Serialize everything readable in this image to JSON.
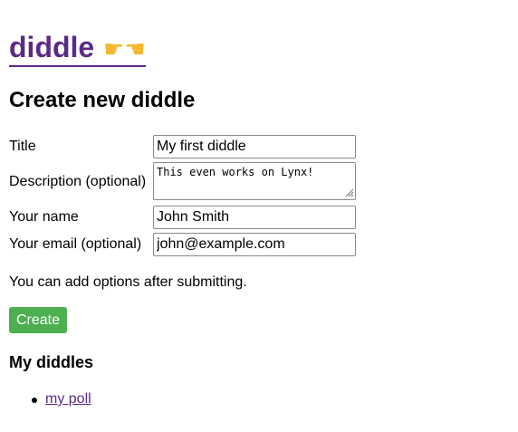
{
  "header": {
    "logo_text": "diddle",
    "logo_icon": "pointing-hands-emoji"
  },
  "form": {
    "heading": "Create new diddle",
    "fields": [
      {
        "label": "Title",
        "value": "My first diddle"
      },
      {
        "label": "Description (optional)",
        "value": "This even works on Lynx!"
      },
      {
        "label": "Your name",
        "value": "John Smith"
      },
      {
        "label": "Your email (optional)",
        "value": "john@example.com"
      }
    ],
    "hint": "You can add options after submitting.",
    "submit_label": "Create"
  },
  "my_diddles": {
    "heading": "My diddles",
    "items": [
      {
        "label": "my poll"
      }
    ]
  },
  "colors": {
    "link": "#5b2a86",
    "button_bg": "#4caf50",
    "button_text": "#ffffff"
  }
}
